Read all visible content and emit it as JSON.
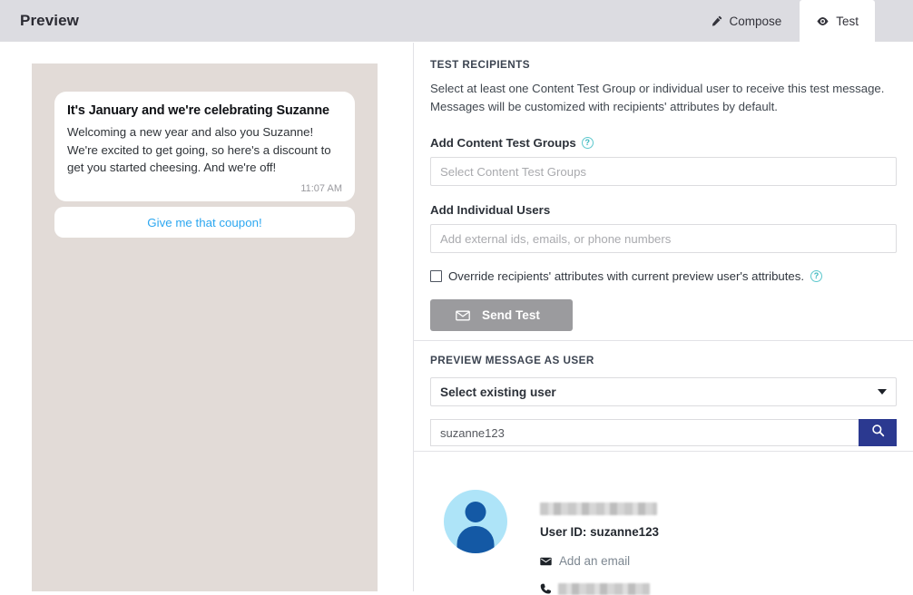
{
  "header": {
    "title": "Preview",
    "tabs": [
      {
        "label": "Compose",
        "icon": "pencil-icon",
        "active": false
      },
      {
        "label": "Test",
        "icon": "eye-icon",
        "active": true
      }
    ]
  },
  "preview": {
    "message": {
      "title": "It's January and we're celebrating Suzanne",
      "body": "Welcoming a new year and also you Suzanne! We're excited to get going, so here's a discount to get you started cheesing. And we're off!",
      "time": "11:07 AM"
    },
    "cta_label": "Give me that coupon!",
    "background_color": "#e2dbd7",
    "cta_color": "#2ca7f0"
  },
  "test_recipients": {
    "section_title": "TEST RECIPIENTS",
    "description": "Select at least one Content Test Group or individual user to receive this test message. Messages will be customized with recipients' attributes by default.",
    "content_groups": {
      "label": "Add Content Test Groups",
      "help_icon": "help-circle-icon",
      "help_glyph": "?",
      "placeholder": "Select Content Test Groups",
      "value": ""
    },
    "individual_users": {
      "label": "Add Individual Users",
      "placeholder": "Add external ids, emails, or phone numbers",
      "value": ""
    },
    "override": {
      "label": "Override recipients' attributes with current preview user's attributes.",
      "checked": false,
      "help_icon": "help-circle-icon",
      "help_glyph": "?"
    },
    "send_button": {
      "label": "Send Test",
      "icon": "envelope-icon",
      "enabled": false,
      "color": "#9b9b9e"
    }
  },
  "preview_as_user": {
    "section_title": "PREVIEW MESSAGE AS USER",
    "select": {
      "value": "Select existing user",
      "icon": "chevron-down-icon"
    },
    "search": {
      "value": "suzanne123",
      "placeholder": "",
      "button_icon": "search-icon",
      "button_color": "#2b3990"
    },
    "user": {
      "avatar_icon": "user-avatar-icon",
      "name_redacted": true,
      "user_id_label": "User ID: suzanne123",
      "email_label": "Add an email",
      "email_icon": "envelope-icon",
      "phone_icon": "phone-icon",
      "phone_redacted": true
    }
  }
}
